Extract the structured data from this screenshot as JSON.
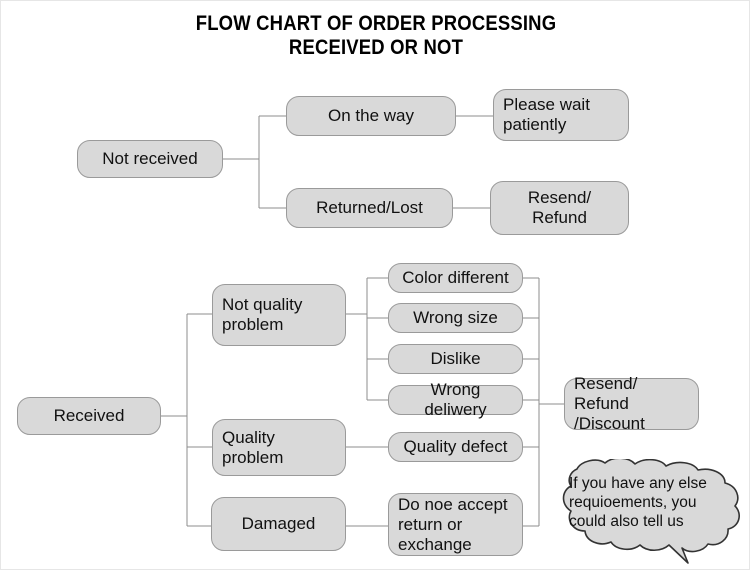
{
  "title": "FLOW CHART OF ORDER PROCESSING\nRECEIVED OR NOT",
  "colors": {
    "node_fill": "#d9d9d9",
    "node_border": "#9a9a9a",
    "connector": "#8c8c8c",
    "background": "#ffffff",
    "text": "#111111"
  },
  "chart_data": {
    "type": "diagram",
    "title": "FLOW CHART OF ORDER PROCESSING RECEIVED OR NOT",
    "branches": [
      {
        "root": "Not received",
        "children": [
          {
            "label": "On the way",
            "outcome": "Please wait\npatiently"
          },
          {
            "label": "Returned/Lost",
            "outcome": "Resend/\nRefund"
          }
        ]
      },
      {
        "root": "Received",
        "children": [
          {
            "label": "Not quality\nproblem",
            "reasons": [
              "Color different",
              "Wrong size",
              "Dislike",
              "Wrong deliwery"
            ],
            "outcome": "Resend/ Refund\n/Discount"
          },
          {
            "label": "Quality\nproblem",
            "reasons": [
              "Quality defect"
            ],
            "outcome": "Resend/ Refund\n/Discount"
          },
          {
            "label": "Damaged",
            "reasons": [
              "Do noe accept\nreturn or\nexchange"
            ],
            "outcome": "Resend/ Refund\n/Discount"
          }
        ]
      }
    ],
    "note": "If you have any else\nrequioements, you\ncould also tell us"
  },
  "nodes": {
    "not_received": "Not received",
    "on_the_way": "On the way",
    "please_wait": "Please wait\npatiently",
    "returned_lost": "Returned/Lost",
    "resend_refund": "Resend/\nRefund",
    "received": "Received",
    "not_quality_problem": "Not quality\nproblem",
    "quality_problem": "Quality\nproblem",
    "damaged": "Damaged",
    "color_different": "Color different",
    "wrong_size": "Wrong size",
    "dislike": "Dislike",
    "wrong_deliwery": "Wrong deliwery",
    "quality_defect": "Quality defect",
    "do_noe_accept": "Do noe accept\nreturn or\nexchange",
    "resend_refund_discount": "Resend/ Refund\n/Discount"
  },
  "callout": {
    "text": "If you have any else\nrequioements, you\ncould also tell us"
  }
}
